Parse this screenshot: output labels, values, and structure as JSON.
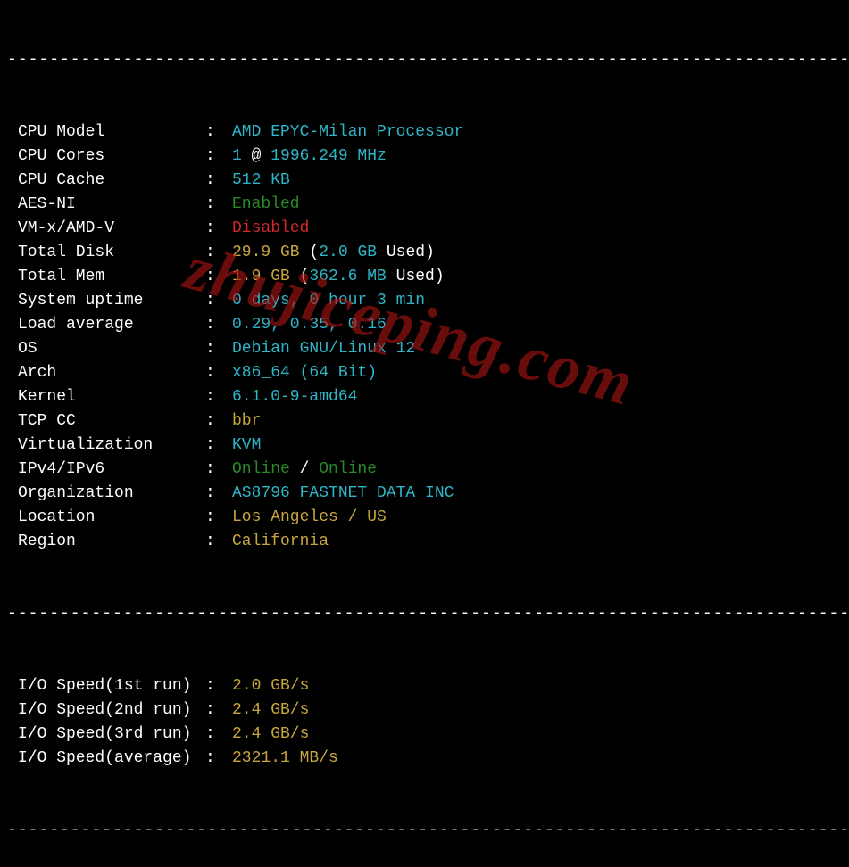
{
  "sep": "----------------------------------------------------------------------------------------------",
  "rows1": [
    {
      "label": "CPU Model",
      "value": [
        {
          "t": "AMD EPYC-Milan Processor",
          "c": "cyan"
        }
      ]
    },
    {
      "label": "CPU Cores",
      "value": [
        {
          "t": "1",
          "c": "cyan"
        },
        {
          "t": " @ ",
          "c": "white"
        },
        {
          "t": "1996.249 MHz",
          "c": "cyan"
        }
      ]
    },
    {
      "label": "CPU Cache",
      "value": [
        {
          "t": "512 KB",
          "c": "cyan"
        }
      ]
    },
    {
      "label": "AES-NI",
      "value": [
        {
          "t": "Enabled",
          "c": "green"
        }
      ]
    },
    {
      "label": "VM-x/AMD-V",
      "value": [
        {
          "t": "Disabled",
          "c": "red"
        }
      ]
    },
    {
      "label": "Total Disk",
      "value": [
        {
          "t": "29.9 GB",
          "c": "yellow"
        },
        {
          "t": " (",
          "c": "white"
        },
        {
          "t": "2.0 GB",
          "c": "cyan"
        },
        {
          "t": " Used)",
          "c": "white"
        }
      ]
    },
    {
      "label": "Total Mem",
      "value": [
        {
          "t": "1.9 GB",
          "c": "yellow"
        },
        {
          "t": " (",
          "c": "white"
        },
        {
          "t": "362.6 MB",
          "c": "cyan"
        },
        {
          "t": " Used)",
          "c": "white"
        }
      ]
    },
    {
      "label": "System uptime",
      "value": [
        {
          "t": "0 days, 0 hour 3 min",
          "c": "cyan"
        }
      ]
    },
    {
      "label": "Load average",
      "value": [
        {
          "t": "0.29, 0.35, 0.16",
          "c": "cyan"
        }
      ]
    },
    {
      "label": "OS",
      "value": [
        {
          "t": "Debian GNU/Linux 12",
          "c": "cyan"
        }
      ]
    },
    {
      "label": "Arch",
      "value": [
        {
          "t": "x86_64 (64 Bit)",
          "c": "cyan"
        }
      ]
    },
    {
      "label": "Kernel",
      "value": [
        {
          "t": "6.1.0-9-amd64",
          "c": "cyan"
        }
      ]
    },
    {
      "label": "TCP CC",
      "value": [
        {
          "t": "bbr",
          "c": "yellow"
        }
      ]
    },
    {
      "label": "Virtualization",
      "value": [
        {
          "t": "KVM",
          "c": "cyan"
        }
      ]
    },
    {
      "label": "IPv4/IPv6",
      "value": [
        {
          "t": "Online",
          "c": "green"
        },
        {
          "t": " / ",
          "c": "white"
        },
        {
          "t": "Online",
          "c": "green"
        }
      ]
    },
    {
      "label": "Organization",
      "value": [
        {
          "t": "AS8796 FASTNET DATA INC",
          "c": "cyan"
        }
      ]
    },
    {
      "label": "Location",
      "value": [
        {
          "t": "Los Angeles / US",
          "c": "yellow"
        }
      ]
    },
    {
      "label": "Region",
      "value": [
        {
          "t": "California",
          "c": "yellow"
        }
      ]
    }
  ],
  "rows2": [
    {
      "label": "I/O Speed(1st run)",
      "value": [
        {
          "t": "2.0 GB/s",
          "c": "yellow"
        }
      ]
    },
    {
      "label": "I/O Speed(2nd run)",
      "value": [
        {
          "t": "2.4 GB/s",
          "c": "yellow"
        }
      ]
    },
    {
      "label": "I/O Speed(3rd run)",
      "value": [
        {
          "t": "2.4 GB/s",
          "c": "yellow"
        }
      ]
    },
    {
      "label": "I/O Speed(average)",
      "value": [
        {
          "t": "2321.1 MB/s",
          "c": "yellow"
        }
      ]
    }
  ],
  "watermark": "zhujiceping.com"
}
